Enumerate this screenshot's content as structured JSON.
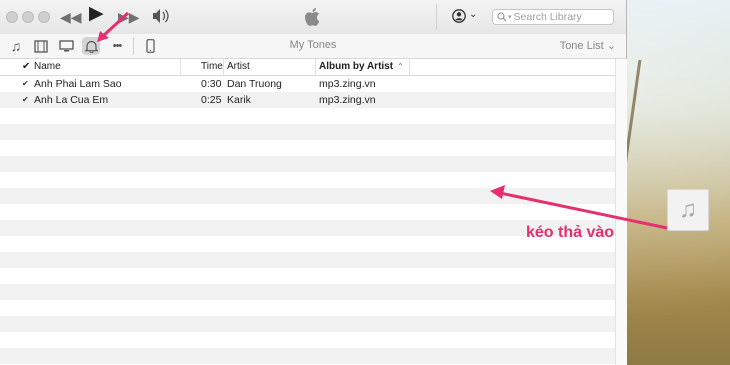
{
  "titlebar": {
    "search_placeholder": "Search Library",
    "account_chevron": "⌄"
  },
  "toolbar": {
    "title": "My Tones",
    "view_menu": "Tone List ⌄",
    "more": "•••"
  },
  "columns": {
    "name": "Name",
    "time": "Time",
    "artist": "Artist",
    "album": "Album by Artist"
  },
  "tracks": [
    {
      "checked": "✔",
      "name": "Anh Phai Lam Sao",
      "time": "0:30",
      "artist": "Dan Truong",
      "album": "mp3.zing.vn"
    },
    {
      "checked": "✔",
      "name": "Anh La Cua Em",
      "time": "0:25",
      "artist": "Karik",
      "album": "mp3.zing.vn"
    }
  ],
  "annotation": {
    "caption": "kéo thả vào",
    "color": "#e4306f"
  },
  "colors": {
    "accent": "#e4306f"
  }
}
